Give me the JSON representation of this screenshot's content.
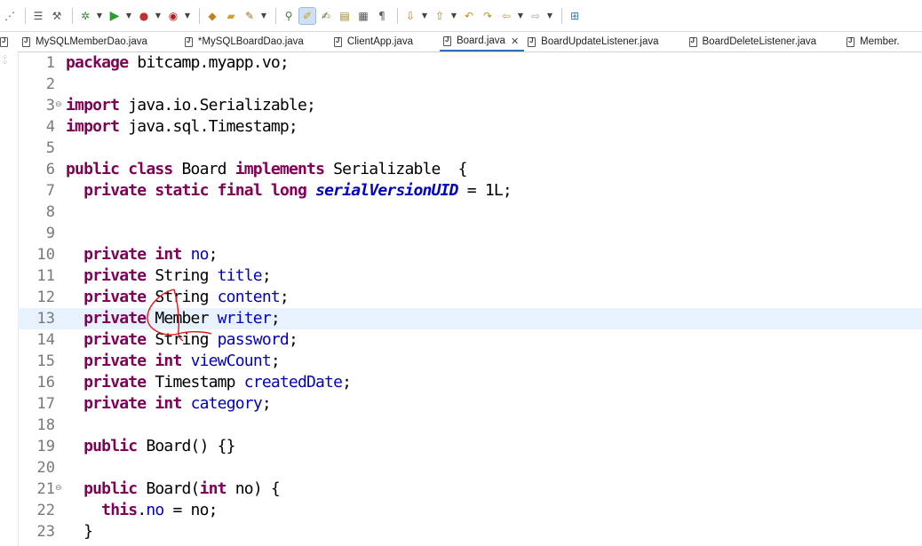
{
  "tabs": [
    {
      "label": "MySQLMemberDao.java",
      "active": false
    },
    {
      "label": "*MySQLBoardDao.java",
      "active": false
    },
    {
      "label": "ClientApp.java",
      "active": false
    },
    {
      "label": "Board.java",
      "active": true
    },
    {
      "label": "BoardUpdateListener.java",
      "active": false
    },
    {
      "label": "BoardDeleteListener.java",
      "active": false
    },
    {
      "label": "Member.",
      "active": false
    }
  ],
  "toolbar_icons": [
    "new-icon",
    "save-icon",
    "debug-icon",
    "run-icon",
    "coverage-icon",
    "external-tools-icon",
    "new-package-icon",
    "open-folder-icon",
    "open-type-icon",
    "search-icon",
    "mark-occurrences-icon",
    "annotation-icon",
    "breadcrumb-icon",
    "show-whitespace-icon",
    "next-annotation-icon",
    "previous-annotation-icon",
    "last-edit-icon",
    "back-icon",
    "forward-icon",
    "open-perspective-icon"
  ],
  "colors": {
    "keyword": "#7f0055",
    "field": "#0000c0",
    "current_line": "#e8f2fe",
    "line_number": "#787878"
  },
  "editor": {
    "current_line": 13,
    "lines": [
      {
        "n": "1",
        "fold": "",
        "tokens": [
          {
            "t": "package",
            "c": "kw"
          },
          {
            "t": " bitcamp.myapp.vo;"
          }
        ]
      },
      {
        "n": "2",
        "fold": "",
        "tokens": []
      },
      {
        "n": "3",
        "fold": "⊖",
        "tokens": [
          {
            "t": "import",
            "c": "kw"
          },
          {
            "t": " java.io.Serializable;"
          }
        ]
      },
      {
        "n": "4",
        "fold": "",
        "tokens": [
          {
            "t": "import",
            "c": "kw"
          },
          {
            "t": " java.sql.Timestamp;"
          }
        ]
      },
      {
        "n": "5",
        "fold": "",
        "tokens": []
      },
      {
        "n": "6",
        "fold": "",
        "tokens": [
          {
            "t": "public",
            "c": "kw"
          },
          {
            "t": " "
          },
          {
            "t": "class",
            "c": "kw"
          },
          {
            "t": " Board "
          },
          {
            "t": "implements",
            "c": "kw"
          },
          {
            "t": " Serializable  {"
          }
        ]
      },
      {
        "n": "7",
        "fold": "",
        "tokens": [
          {
            "t": "  "
          },
          {
            "t": "private",
            "c": "kw"
          },
          {
            "t": " "
          },
          {
            "t": "static",
            "c": "kw"
          },
          {
            "t": " "
          },
          {
            "t": "final",
            "c": "kw"
          },
          {
            "t": " "
          },
          {
            "t": "long",
            "c": "kw"
          },
          {
            "t": " "
          },
          {
            "t": "serialVersionUID",
            "c": "sfld"
          },
          {
            "t": " = 1L;"
          }
        ]
      },
      {
        "n": "8",
        "fold": "",
        "tokens": []
      },
      {
        "n": "9",
        "fold": "",
        "tokens": []
      },
      {
        "n": "10",
        "fold": "",
        "tokens": [
          {
            "t": "  "
          },
          {
            "t": "private",
            "c": "kw"
          },
          {
            "t": " "
          },
          {
            "t": "int",
            "c": "kw"
          },
          {
            "t": " "
          },
          {
            "t": "no",
            "c": "fld"
          },
          {
            "t": ";"
          }
        ]
      },
      {
        "n": "11",
        "fold": "",
        "tokens": [
          {
            "t": "  "
          },
          {
            "t": "private",
            "c": "kw"
          },
          {
            "t": " String "
          },
          {
            "t": "title",
            "c": "fld"
          },
          {
            "t": ";"
          }
        ]
      },
      {
        "n": "12",
        "fold": "",
        "tokens": [
          {
            "t": "  "
          },
          {
            "t": "private",
            "c": "kw"
          },
          {
            "t": " String "
          },
          {
            "t": "content",
            "c": "fld"
          },
          {
            "t": ";"
          }
        ]
      },
      {
        "n": "13",
        "fold": "",
        "tokens": [
          {
            "t": "  "
          },
          {
            "t": "private",
            "c": "kw"
          },
          {
            "t": " Member "
          },
          {
            "t": "writer",
            "c": "fld"
          },
          {
            "t": ";"
          }
        ]
      },
      {
        "n": "14",
        "fold": "",
        "tokens": [
          {
            "t": "  "
          },
          {
            "t": "private",
            "c": "kw"
          },
          {
            "t": " String "
          },
          {
            "t": "password",
            "c": "fld"
          },
          {
            "t": ";"
          }
        ]
      },
      {
        "n": "15",
        "fold": "",
        "tokens": [
          {
            "t": "  "
          },
          {
            "t": "private",
            "c": "kw"
          },
          {
            "t": " "
          },
          {
            "t": "int",
            "c": "kw"
          },
          {
            "t": " "
          },
          {
            "t": "viewCount",
            "c": "fld"
          },
          {
            "t": ";"
          }
        ]
      },
      {
        "n": "16",
        "fold": "",
        "tokens": [
          {
            "t": "  "
          },
          {
            "t": "private",
            "c": "kw"
          },
          {
            "t": " Timestamp "
          },
          {
            "t": "createdDate",
            "c": "fld"
          },
          {
            "t": ";"
          }
        ]
      },
      {
        "n": "17",
        "fold": "",
        "tokens": [
          {
            "t": "  "
          },
          {
            "t": "private",
            "c": "kw"
          },
          {
            "t": " "
          },
          {
            "t": "int",
            "c": "kw"
          },
          {
            "t": " "
          },
          {
            "t": "category",
            "c": "fld"
          },
          {
            "t": ";"
          }
        ]
      },
      {
        "n": "18",
        "fold": "",
        "tokens": []
      },
      {
        "n": "19",
        "fold": "",
        "tokens": [
          {
            "t": "  "
          },
          {
            "t": "public",
            "c": "kw"
          },
          {
            "t": " Board() {}"
          }
        ]
      },
      {
        "n": "20",
        "fold": "",
        "tokens": []
      },
      {
        "n": "21",
        "fold": "⊖",
        "tokens": [
          {
            "t": "  "
          },
          {
            "t": "public",
            "c": "kw"
          },
          {
            "t": " Board("
          },
          {
            "t": "int",
            "c": "kw"
          },
          {
            "t": " no) {"
          }
        ]
      },
      {
        "n": "22",
        "fold": "",
        "tokens": [
          {
            "t": "    "
          },
          {
            "t": "this",
            "c": "kw"
          },
          {
            "t": "."
          },
          {
            "t": "no",
            "c": "fld"
          },
          {
            "t": " = no;"
          }
        ]
      },
      {
        "n": "23",
        "fold": "",
        "tokens": [
          {
            "t": "  }"
          }
        ]
      }
    ]
  }
}
